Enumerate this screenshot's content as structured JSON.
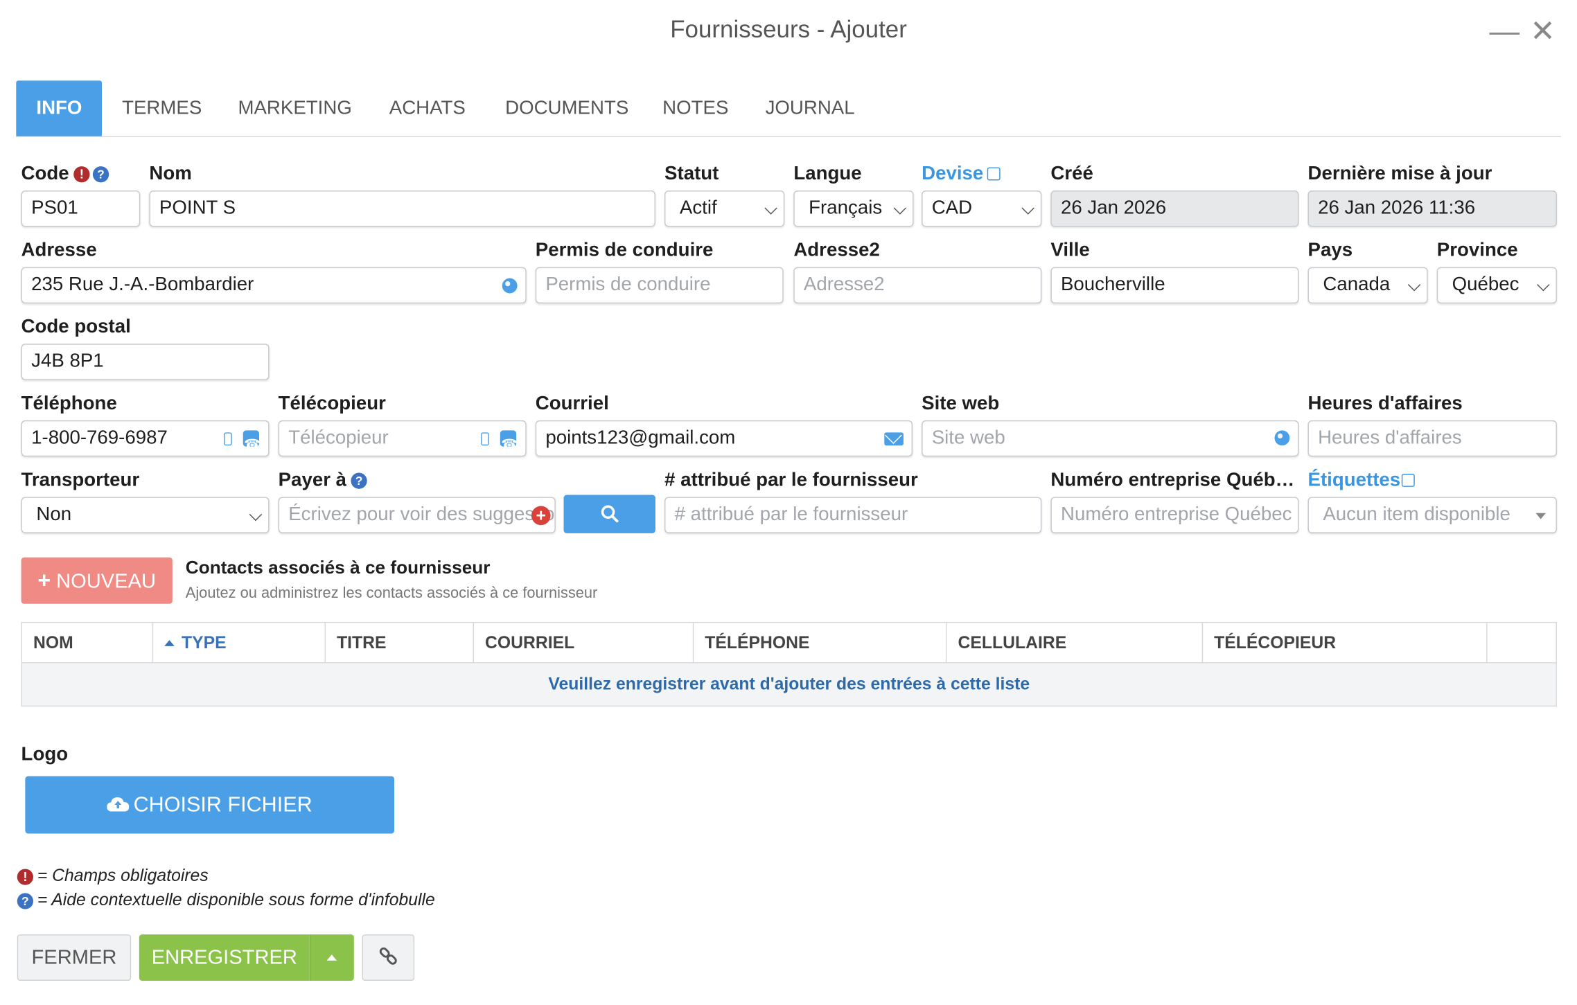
{
  "window": {
    "title": "Fournisseurs - Ajouter"
  },
  "tabs": [
    "INFO",
    "TERMES",
    "MARKETING",
    "ACHATS",
    "DOCUMENTS",
    "NOTES",
    "JOURNAL"
  ],
  "fields": {
    "code": {
      "label": "Code",
      "value": "PS01"
    },
    "nom": {
      "label": "Nom",
      "value": "POINT S"
    },
    "statut": {
      "label": "Statut",
      "value": "Actif"
    },
    "langue": {
      "label": "Langue",
      "value": "Français"
    },
    "devise": {
      "label": "Devise",
      "value": "CAD"
    },
    "cree": {
      "label": "Créé",
      "value": "26 Jan 2026"
    },
    "maj": {
      "label": "Dernière mise à jour",
      "value": "26 Jan 2026 11:36"
    },
    "adresse": {
      "label": "Adresse",
      "value": "235 Rue J.-A.-Bombardier"
    },
    "permis": {
      "label": "Permis de conduire",
      "placeholder": "Permis de conduire"
    },
    "adresse2": {
      "label": "Adresse2",
      "placeholder": "Adresse2"
    },
    "ville": {
      "label": "Ville",
      "value": "Boucherville"
    },
    "pays": {
      "label": "Pays",
      "value": "Canada"
    },
    "province": {
      "label": "Province",
      "value": "Québec"
    },
    "code_postal": {
      "label": "Code postal",
      "value": "J4B 8P1"
    },
    "telephone": {
      "label": "Téléphone",
      "value": "1-800-769-6987"
    },
    "telecopieur": {
      "label": "Télécopieur",
      "placeholder": "Télécopieur"
    },
    "courriel": {
      "label": "Courriel",
      "value": "points123@gmail.com"
    },
    "site_web": {
      "label": "Site web",
      "placeholder": "Site web"
    },
    "heures": {
      "label": "Heures d'affaires",
      "placeholder": "Heures d'affaires"
    },
    "transporteur": {
      "label": "Transporteur",
      "value": "Non"
    },
    "payer_a": {
      "label": "Payer à",
      "placeholder": "Écrivez pour voir des suggestions"
    },
    "attribue": {
      "label": "# attribué par le fournisseur",
      "placeholder": "# attribué par le fournisseur"
    },
    "neq": {
      "label": "Numéro entreprise Québ…",
      "placeholder": "Numéro entreprise Québec"
    },
    "etiquettes": {
      "label": "Étiquettes",
      "placeholder": "Aucun item disponible"
    }
  },
  "contacts": {
    "new_button": "NOUVEAU",
    "title": "Contacts associés à ce fournisseur",
    "subtitle": "Ajoutez ou administrez les contacts associés à ce fournisseur",
    "columns": [
      "NOM",
      "TYPE",
      "TITRE",
      "COURRIEL",
      "TÉLÉPHONE",
      "CELLULAIRE",
      "TÉLÉCOPIEUR"
    ],
    "empty_message": "Veuillez enregistrer avant d'ajouter des entrées à cette liste"
  },
  "logo": {
    "label": "Logo",
    "button": "CHOISIR FICHIER"
  },
  "legend": {
    "required": "= Champs obligatoires",
    "help": "= Aide contextuelle disponible sous forme d'infobulle"
  },
  "footer": {
    "close": "FERMER",
    "save": "ENREGISTRER"
  },
  "colors": {
    "accent": "#4a9fe6",
    "save": "#8bc34a",
    "new": "#ef8a84",
    "required": "#b02d2d",
    "help": "#3c72c2"
  }
}
